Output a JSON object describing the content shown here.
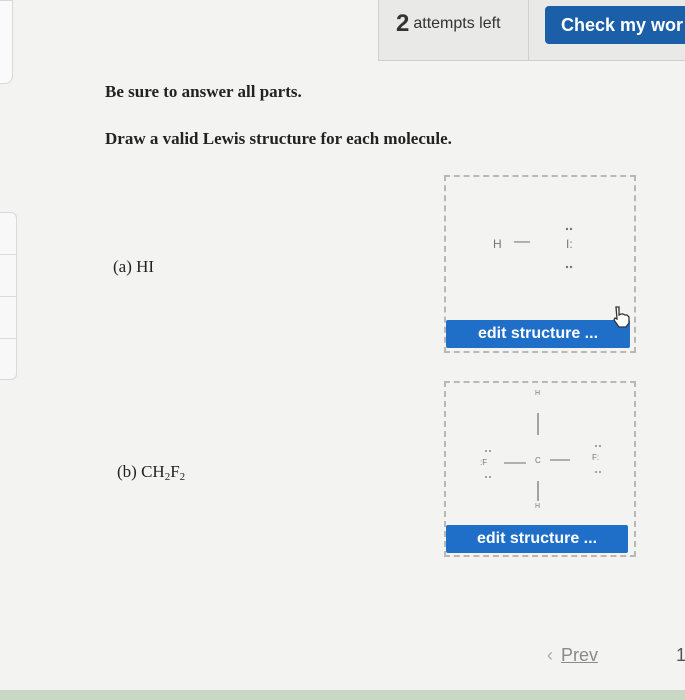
{
  "header": {
    "attempts_count": "2",
    "attempts_label": "attempts left",
    "check_button_label": "Check my wor"
  },
  "instructions": {
    "line1": "Be sure to answer all parts.",
    "line2": "Draw a valid Lewis structure for each molecule."
  },
  "questions": [
    {
      "prefix": "(a) ",
      "formula": "HI",
      "edit_label": "edit structure ...",
      "structure": {
        "h": "H",
        "bond": "—",
        "i": "I:"
      }
    },
    {
      "prefix": "(b) ",
      "formula_parts": [
        "CH",
        "2",
        "F",
        "2"
      ],
      "edit_label": "edit structure ...",
      "structure": {
        "top_h": "H",
        "bottom_h": "H",
        "c": "C",
        "left_f": ":F",
        "right_f": "F:"
      }
    }
  ],
  "navigation": {
    "prev_label": "Prev",
    "page_number": "1"
  },
  "colors": {
    "check_button": "#1b5fa8",
    "edit_button": "#1f6fc9"
  }
}
